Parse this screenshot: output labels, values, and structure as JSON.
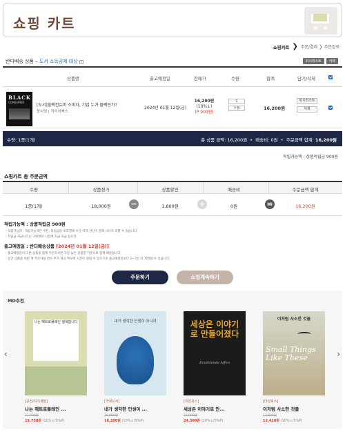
{
  "header": {
    "title": "쇼핑 카트"
  },
  "steps": {
    "current": "쇼핑카트",
    "step2": "주문/결제",
    "step3": "주문완료"
  },
  "cart_section": {
    "title": "반디배송 상품",
    "category": "도서 소득공제 대상",
    "wishlist_btn": "위시리스트",
    "delete_btn": "삭제"
  },
  "columns": {
    "product": "상품명",
    "delivery": "출고예정일",
    "price": "판매가",
    "qty": "수량",
    "sum": "합계",
    "actions": "담기/삭제"
  },
  "item": {
    "cover_title": "BLACK",
    "cover_sub": "CONSUMER",
    "name": "[도서]블랙컨슈머 소비자, 기업 누가 블랙인가?",
    "publisher": "윤서영 | 커리어북스",
    "delivery_date": "2024년 01월 12일(금)",
    "price": "16,200원",
    "discount": "(10%↓)",
    "points": "(P 900원)",
    "qty": "1",
    "qty_btn": "수정",
    "sum": "16,200원",
    "wish_btn": "위시리스트",
    "del_btn": "삭제"
  },
  "summary_bar": {
    "count": "수량: 1종(1개)",
    "products": "총 상품 금액: 16,200원",
    "delivery": "배송비: 0원",
    "total_label": "주문금액 합계:",
    "total": "16,200원"
  },
  "points_line": "적립가능액 : 상품적립금 900원",
  "total_section": {
    "title": "쇼핑카트 총 주문금액",
    "headers": [
      "수량",
      "상품정가",
      "상품할인",
      "배송비",
      "주문금액 합계"
    ],
    "values": [
      "1종(1개)",
      "18,000원",
      "1,800원",
      "0원",
      "16,200원"
    ]
  },
  "info": {
    "points_title": "적립가능액 : 상품적립금 900원",
    "points_notes": [
      "적립가능액 : 적립가능액은 쿠폰, 적립금등 보조결제 수단 이하 잔단어 결제 시이가 의를 수 있습니다.",
      "적립금 지급시기는 구매완료 시점에 지급 지급 됩니다."
    ],
    "delivery_title": "출고예정일 : 반디배송상품",
    "delivery_date": "[2024년 01월 12일(금)]",
    "delivery_notes": [
      "출고예정일이 다른 상품을 함께 주문하시면 가장 늦은 상품을 기준으로 함께 배송됩니다.",
      "일간 상품을 비반 께 주문하실 경우 추가 재고 확보에 시간이 걸릴 수 있으므로 출고예정일보다 2~3일 더 지연될 수 있습니다."
    ]
  },
  "buttons": {
    "order": "주문하기",
    "continue": "쇼핑계속하기"
  },
  "md": {
    "title": "MD추천",
    "books": [
      {
        "cat": "[공전/자기계발]",
        "title": "나는 해트로플레인 ...",
        "orig": "17,500원",
        "price": "15,750원",
        "rate": "(10%↓/5%P)",
        "cover": "나는 해트로플레인 행복합니다"
      },
      {
        "cat": "[국내도서]",
        "title": "내가 생각한 인생이 ...",
        "orig": "18,000원",
        "price": "16,200원",
        "rate": "(10%↓/5%P)",
        "cover": "내가 생각한 인생이 아니야"
      },
      {
        "cat": "[유진퍼스]",
        "title": "세상은 이야기로 만...",
        "orig": "27,000원",
        "price": "24,300원",
        "rate": "(10%↓/5%P)",
        "cover": "세상은 이야기로 만들어졌다",
        "cover_sub": "Erzählende Affen"
      },
      {
        "cat": "[다산북스]",
        "title": "이처럼 사소한 것들",
        "orig": "13,800원",
        "price": "12,420원",
        "rate": "(10%↓/5%P)",
        "cover": "이처럼 사소한 것들",
        "cover_sub": "Small Things Like These"
      }
    ]
  },
  "colors": {
    "navy": "#1f2746",
    "accent_red": "#d8382b",
    "brown": "#6b4a3a",
    "check_blue": "#1b5fc9"
  }
}
